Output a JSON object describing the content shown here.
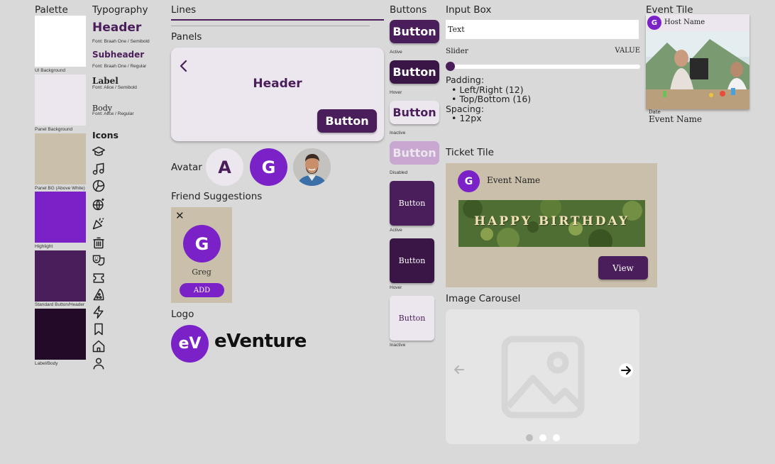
{
  "colors": {
    "ui_background": "#ffffff",
    "panel_background": "#ece6ee",
    "panel_bg_above_white": "#c9bfaa",
    "highlight": "#7a22c8",
    "standard_button_header": "#4a1e5a",
    "label_body": "#220a28"
  },
  "palette": {
    "title": "Palette",
    "swatches": [
      {
        "label": "UI Background"
      },
      {
        "label": "Panel Background"
      },
      {
        "label": "Panel BG (Above White)"
      },
      {
        "label": "Highlight"
      },
      {
        "label": "Standard Button/Header"
      },
      {
        "label": "Label/Body"
      }
    ]
  },
  "typography": {
    "title": "Typography",
    "header": {
      "text": "Header",
      "font": "Font: Braah One / Semibold"
    },
    "subheader": {
      "text": "Subheader",
      "font": "Font: Braah One / Regular"
    },
    "label": {
      "text": "Label",
      "font": "Font: Alice / Semibold"
    },
    "body": {
      "text": "Body",
      "font": "Font: Alice / Regular"
    }
  },
  "icons": {
    "title": "Icons",
    "list": [
      "graduation-cap-icon",
      "music-note-icon",
      "volleyball-icon",
      "disco-ball-icon",
      "party-popper-icon",
      "trash-bin-icon",
      "theater-masks-icon",
      "ticket-icon",
      "pizza-icon",
      "lightning-icon",
      "bookmark-icon",
      "home-icon",
      "user-icon"
    ]
  },
  "lines": {
    "title": "Lines"
  },
  "panels": {
    "title": "Panels",
    "header": "Header",
    "button": "Button",
    "back_icon": "chevron-left-icon"
  },
  "avatar": {
    "title": "Avatar",
    "letter_a": "A",
    "letter_g": "G"
  },
  "friend": {
    "title": "Friend Suggestions",
    "close": "✕",
    "initial": "G",
    "name": "Greg",
    "add": "ADD"
  },
  "logo": {
    "title": "Logo",
    "mark": "eV",
    "word": "eVenture"
  },
  "buttons": {
    "title": "Buttons",
    "label": "Button",
    "states": [
      "Active",
      "Hover",
      "Inactive",
      "Disabled",
      "Active",
      "Hover",
      "Inactive"
    ]
  },
  "input_box": {
    "title": "Input Box",
    "value": "Text",
    "slider_label": "Slider",
    "slider_value_label": "VALUE",
    "slider_level": 0,
    "padding_title": "Padding:",
    "padding_items": [
      "Left/Right (12)",
      "Top/Bottom (16)"
    ],
    "spacing_title": "Spacing:",
    "spacing_items": [
      "12px"
    ]
  },
  "event_tile": {
    "title": "Event Tile",
    "initial": "G",
    "host": "Host Name",
    "date": "Date",
    "event": "Event Name"
  },
  "ticket_tile": {
    "title": "Ticket Tile",
    "initial": "G",
    "event": "Event Name",
    "banner": "HAPPY BIRTHDAY",
    "view": "View"
  },
  "carousel": {
    "title": "Image Carousel",
    "dots": 3,
    "active_dot": 0
  }
}
